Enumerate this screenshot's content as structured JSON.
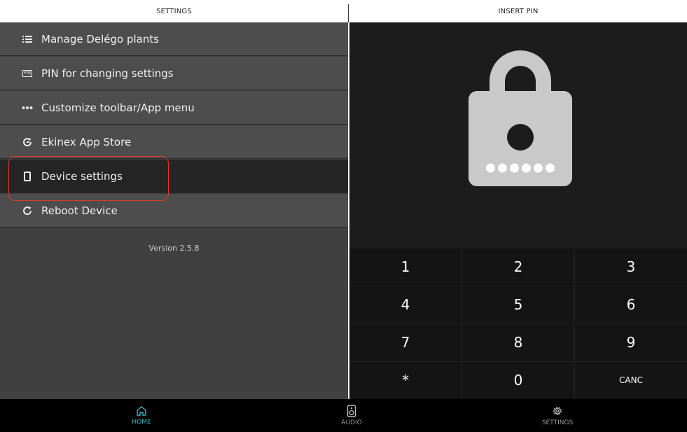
{
  "header": {
    "left_title": "SETTINGS",
    "right_title": "INSERT PIN"
  },
  "menu": {
    "items": [
      {
        "label": "Manage Delégo plants",
        "icon": "list-icon"
      },
      {
        "label": "PIN for changing settings",
        "icon": "pin-icon",
        "icon_text": "PIN"
      },
      {
        "label": "Customize toolbar/App menu",
        "icon": "more-dots-icon"
      },
      {
        "label": "Ekinex App Store",
        "icon": "refresh-icon"
      },
      {
        "label": "Device settings",
        "icon": "tablet-icon",
        "selected": true
      },
      {
        "label": "Reboot Device",
        "icon": "reboot-icon"
      }
    ],
    "version": "Version 2.5.8"
  },
  "pin": {
    "lock_icon": "lock-icon",
    "digits_entered": 6,
    "keys": [
      [
        "1",
        "2",
        "3"
      ],
      [
        "4",
        "5",
        "6"
      ],
      [
        "7",
        "8",
        "9"
      ],
      [
        "*",
        "0",
        "CANC"
      ]
    ]
  },
  "bottom_nav": {
    "tabs": [
      {
        "label": "HOME",
        "icon": "home-icon",
        "active": true
      },
      {
        "label": "AUDIO",
        "icon": "speaker-icon",
        "active": false
      },
      {
        "label": "SETTINGS",
        "icon": "gear-icon",
        "active": false
      }
    ]
  },
  "colors": {
    "accent": "#3fb5c8",
    "highlight_ring": "#e03a22",
    "menu_item_bg": "#4d4d4d",
    "menu_item_selected_bg": "#252525",
    "panel_bg": "#1c1c1c",
    "lock": "#c9c9c9"
  }
}
